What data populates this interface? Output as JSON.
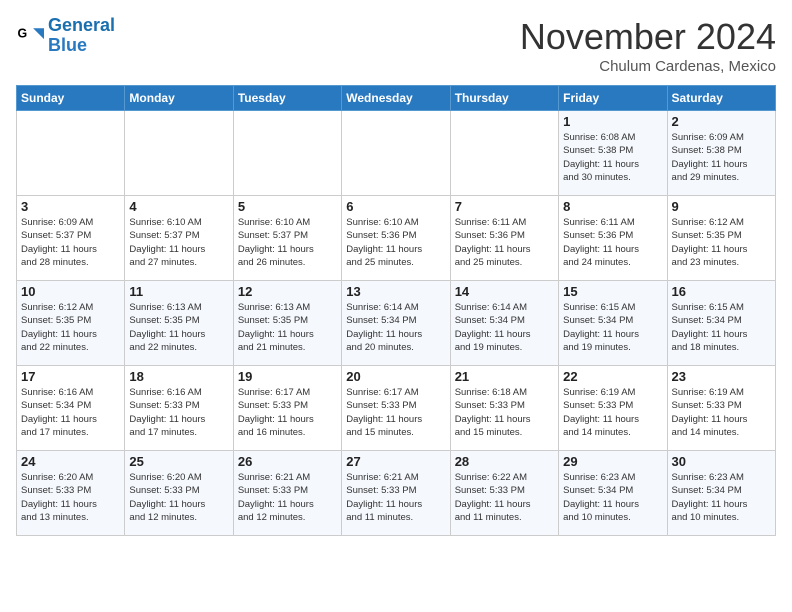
{
  "header": {
    "logo_general": "General",
    "logo_blue": "Blue",
    "title": "November 2024",
    "location": "Chulum Cardenas, Mexico"
  },
  "days_of_week": [
    "Sunday",
    "Monday",
    "Tuesday",
    "Wednesday",
    "Thursday",
    "Friday",
    "Saturday"
  ],
  "weeks": [
    [
      {
        "day": "",
        "info": ""
      },
      {
        "day": "",
        "info": ""
      },
      {
        "day": "",
        "info": ""
      },
      {
        "day": "",
        "info": ""
      },
      {
        "day": "",
        "info": ""
      },
      {
        "day": "1",
        "info": "Sunrise: 6:08 AM\nSunset: 5:38 PM\nDaylight: 11 hours\nand 30 minutes."
      },
      {
        "day": "2",
        "info": "Sunrise: 6:09 AM\nSunset: 5:38 PM\nDaylight: 11 hours\nand 29 minutes."
      }
    ],
    [
      {
        "day": "3",
        "info": "Sunrise: 6:09 AM\nSunset: 5:37 PM\nDaylight: 11 hours\nand 28 minutes."
      },
      {
        "day": "4",
        "info": "Sunrise: 6:10 AM\nSunset: 5:37 PM\nDaylight: 11 hours\nand 27 minutes."
      },
      {
        "day": "5",
        "info": "Sunrise: 6:10 AM\nSunset: 5:37 PM\nDaylight: 11 hours\nand 26 minutes."
      },
      {
        "day": "6",
        "info": "Sunrise: 6:10 AM\nSunset: 5:36 PM\nDaylight: 11 hours\nand 25 minutes."
      },
      {
        "day": "7",
        "info": "Sunrise: 6:11 AM\nSunset: 5:36 PM\nDaylight: 11 hours\nand 25 minutes."
      },
      {
        "day": "8",
        "info": "Sunrise: 6:11 AM\nSunset: 5:36 PM\nDaylight: 11 hours\nand 24 minutes."
      },
      {
        "day": "9",
        "info": "Sunrise: 6:12 AM\nSunset: 5:35 PM\nDaylight: 11 hours\nand 23 minutes."
      }
    ],
    [
      {
        "day": "10",
        "info": "Sunrise: 6:12 AM\nSunset: 5:35 PM\nDaylight: 11 hours\nand 22 minutes."
      },
      {
        "day": "11",
        "info": "Sunrise: 6:13 AM\nSunset: 5:35 PM\nDaylight: 11 hours\nand 22 minutes."
      },
      {
        "day": "12",
        "info": "Sunrise: 6:13 AM\nSunset: 5:35 PM\nDaylight: 11 hours\nand 21 minutes."
      },
      {
        "day": "13",
        "info": "Sunrise: 6:14 AM\nSunset: 5:34 PM\nDaylight: 11 hours\nand 20 minutes."
      },
      {
        "day": "14",
        "info": "Sunrise: 6:14 AM\nSunset: 5:34 PM\nDaylight: 11 hours\nand 19 minutes."
      },
      {
        "day": "15",
        "info": "Sunrise: 6:15 AM\nSunset: 5:34 PM\nDaylight: 11 hours\nand 19 minutes."
      },
      {
        "day": "16",
        "info": "Sunrise: 6:15 AM\nSunset: 5:34 PM\nDaylight: 11 hours\nand 18 minutes."
      }
    ],
    [
      {
        "day": "17",
        "info": "Sunrise: 6:16 AM\nSunset: 5:34 PM\nDaylight: 11 hours\nand 17 minutes."
      },
      {
        "day": "18",
        "info": "Sunrise: 6:16 AM\nSunset: 5:33 PM\nDaylight: 11 hours\nand 17 minutes."
      },
      {
        "day": "19",
        "info": "Sunrise: 6:17 AM\nSunset: 5:33 PM\nDaylight: 11 hours\nand 16 minutes."
      },
      {
        "day": "20",
        "info": "Sunrise: 6:17 AM\nSunset: 5:33 PM\nDaylight: 11 hours\nand 15 minutes."
      },
      {
        "day": "21",
        "info": "Sunrise: 6:18 AM\nSunset: 5:33 PM\nDaylight: 11 hours\nand 15 minutes."
      },
      {
        "day": "22",
        "info": "Sunrise: 6:19 AM\nSunset: 5:33 PM\nDaylight: 11 hours\nand 14 minutes."
      },
      {
        "day": "23",
        "info": "Sunrise: 6:19 AM\nSunset: 5:33 PM\nDaylight: 11 hours\nand 14 minutes."
      }
    ],
    [
      {
        "day": "24",
        "info": "Sunrise: 6:20 AM\nSunset: 5:33 PM\nDaylight: 11 hours\nand 13 minutes."
      },
      {
        "day": "25",
        "info": "Sunrise: 6:20 AM\nSunset: 5:33 PM\nDaylight: 11 hours\nand 12 minutes."
      },
      {
        "day": "26",
        "info": "Sunrise: 6:21 AM\nSunset: 5:33 PM\nDaylight: 11 hours\nand 12 minutes."
      },
      {
        "day": "27",
        "info": "Sunrise: 6:21 AM\nSunset: 5:33 PM\nDaylight: 11 hours\nand 11 minutes."
      },
      {
        "day": "28",
        "info": "Sunrise: 6:22 AM\nSunset: 5:33 PM\nDaylight: 11 hours\nand 11 minutes."
      },
      {
        "day": "29",
        "info": "Sunrise: 6:23 AM\nSunset: 5:34 PM\nDaylight: 11 hours\nand 10 minutes."
      },
      {
        "day": "30",
        "info": "Sunrise: 6:23 AM\nSunset: 5:34 PM\nDaylight: 11 hours\nand 10 minutes."
      }
    ]
  ]
}
